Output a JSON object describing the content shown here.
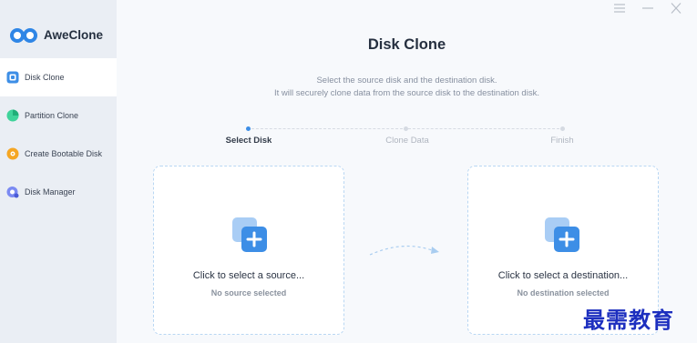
{
  "app": {
    "name": "AweClone"
  },
  "sidebar": {
    "items": [
      {
        "label": "Disk Clone",
        "icon": "disk-clone-icon",
        "color": "#3d8ee6",
        "active": true
      },
      {
        "label": "Partition Clone",
        "icon": "partition-clone-icon",
        "color": "#2ecc8f",
        "active": false
      },
      {
        "label": "Create Bootable Disk",
        "icon": "bootable-disk-icon",
        "color": "#f5a623",
        "active": false
      },
      {
        "label": "Disk Manager",
        "icon": "disk-manager-icon",
        "color": "#6c7df0",
        "active": false
      }
    ]
  },
  "window_controls": [
    "menu-icon",
    "minimize-icon",
    "close-icon"
  ],
  "main": {
    "title": "Disk Clone",
    "description_line1": "Select the source disk and the destination disk.",
    "description_line2": "It will securely clone data from the source disk to the destination disk."
  },
  "steps": [
    {
      "label": "Select Disk",
      "active": true
    },
    {
      "label": "Clone Data",
      "active": false
    },
    {
      "label": "Finish",
      "active": false
    }
  ],
  "source_card": {
    "title": "Click to select a source...",
    "subtitle": "No source selected",
    "icon": "add-disk-icon"
  },
  "destination_card": {
    "title": "Click to select a destination...",
    "subtitle": "No destination selected",
    "icon": "add-disk-icon"
  },
  "watermark": "最需教育",
  "colors": {
    "accent": "#3d8ee6",
    "sidebar_bg": "#eaeef4",
    "main_bg": "#f7f9fc",
    "card_border": "#b9d7f3"
  }
}
